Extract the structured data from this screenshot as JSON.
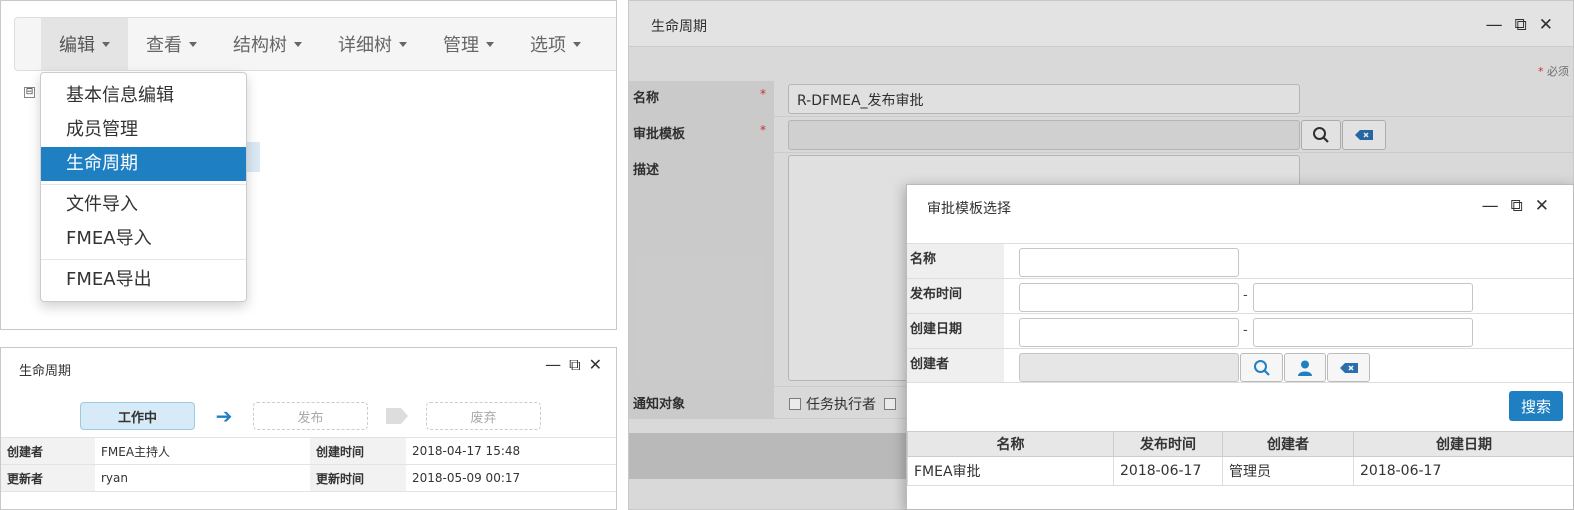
{
  "menu_panel": {
    "menubar": [
      {
        "label": "编辑",
        "active": true
      },
      {
        "label": "查看"
      },
      {
        "label": "结构树"
      },
      {
        "label": "详细树"
      },
      {
        "label": "管理"
      },
      {
        "label": "选项"
      }
    ],
    "tree_toggle": "⊟",
    "dropdown": {
      "basic_info": "基本信息编辑",
      "members": "成员管理",
      "lifecycle": "生命周期",
      "file_import": "文件导入",
      "fmea_import": "FMEA导入",
      "fmea_export": "FMEA导出"
    }
  },
  "life_panel": {
    "title": "生命周期",
    "stages": {
      "current": "工作中",
      "publish": "发布",
      "discard": "废弃"
    },
    "info": {
      "creator_label": "创建者",
      "creator": "FMEA主持人",
      "created_label": "创建时间",
      "created": "2018-04-17 15:48",
      "updater_label": "更新者",
      "updater": "ryan",
      "updated_label": "更新时间",
      "updated": "2018-05-09 00:17"
    }
  },
  "right_panel": {
    "title": "生命周期",
    "required_note": "必须",
    "fields": {
      "name_label": "名称",
      "name_value": "R-DFMEA_发布审批",
      "template_label": "审批模板",
      "desc_label": "描述",
      "notify_label": "通知对象",
      "notify_option": "任务执行者"
    }
  },
  "modal": {
    "title": "审批模板选择",
    "filters": {
      "name": "名称",
      "publish_time": "发布时间",
      "create_date": "创建日期",
      "creator": "创建者",
      "range_sep": "-"
    },
    "search_label": "搜索",
    "table": {
      "headers": [
        "名称",
        "发布时间",
        "创建者",
        "创建日期"
      ],
      "rows": [
        [
          "FMEA审批",
          "2018-06-17",
          "管理员",
          "2018-06-17"
        ]
      ]
    }
  },
  "window_controls": {
    "minimize": "—",
    "maximize": "⧉",
    "close": "✕"
  },
  "icons": {
    "search": "search-icon",
    "user": "user-icon",
    "clear": "clear-backspace-icon"
  },
  "colors": {
    "accent": "#1e7fc2",
    "required": "#dd3333"
  }
}
